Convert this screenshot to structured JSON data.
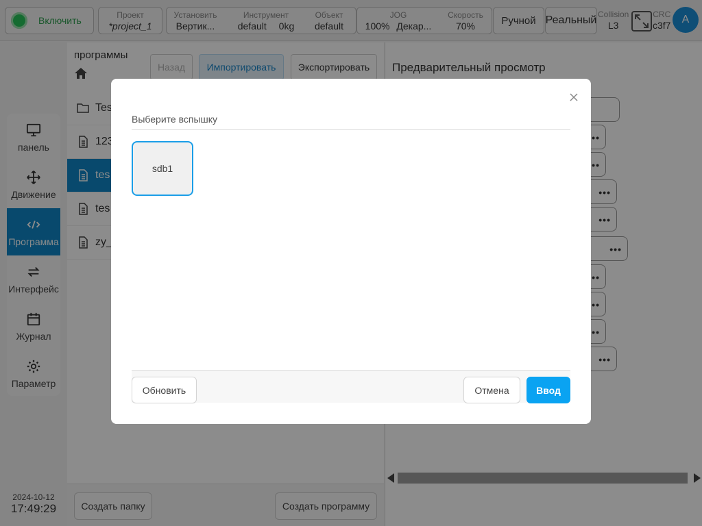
{
  "topbar": {
    "power_label": "Включить",
    "project": {
      "label": "Проект",
      "value": "*project_1"
    },
    "install": {
      "label": "Установить",
      "value": "Вертик..."
    },
    "tool": {
      "label": "Инструмент",
      "value": "default",
      "value2": "0kg"
    },
    "object": {
      "label": "Объект",
      "value": "default"
    },
    "jog": {
      "label": "JOG",
      "value": "100%",
      "value2": "Декар..."
    },
    "speed": {
      "label": "Скорость",
      "value": "70%"
    },
    "mode_manual": "Ручной",
    "mode_real": "Реальный",
    "collision": {
      "label": "Collision",
      "value": "L3"
    },
    "crc": {
      "label": "CRC",
      "value": "c3f7"
    },
    "avatar_letter": "A",
    "colors": {
      "power": "#27c45a",
      "avatar": "#1a8fd8"
    }
  },
  "sidenav": {
    "items": [
      {
        "label": "панель",
        "icon": "monitor-icon"
      },
      {
        "label": "Движение",
        "icon": "move-icon"
      },
      {
        "label": "Программа",
        "icon": "code-icon",
        "active": true
      },
      {
        "label": "Интерфейс",
        "icon": "repeat-icon"
      },
      {
        "label": "Журнал",
        "icon": "calendar-icon"
      },
      {
        "label": "Параметр",
        "icon": "gear-icon"
      }
    ],
    "active_color": "#0f86c6"
  },
  "datetime": {
    "date": "2024-10-12",
    "time": "17:49:29"
  },
  "programs": {
    "title": "программы",
    "back_label": "Назад",
    "import_label": "Импортировать",
    "export_label": "Экспортировать",
    "files": [
      {
        "name": "Tes",
        "type": "folder"
      },
      {
        "name": "123",
        "type": "file"
      },
      {
        "name": "tes",
        "type": "file",
        "active": true
      },
      {
        "name": "tes",
        "type": "file"
      },
      {
        "name": "zy_",
        "type": "file"
      }
    ],
    "create_folder_label": "Создать папку",
    "create_program_label": "Создать программу"
  },
  "preview": {
    "title": "Предварительный просмотр",
    "more_label": "•••"
  },
  "modal": {
    "title": "Выберите вспышку",
    "devices": [
      {
        "name": "sdb1",
        "selected": true
      }
    ],
    "refresh_label": "Обновить",
    "cancel_label": "Отмена",
    "confirm_label": "Ввод",
    "accent_color": "#0aa3f2"
  }
}
